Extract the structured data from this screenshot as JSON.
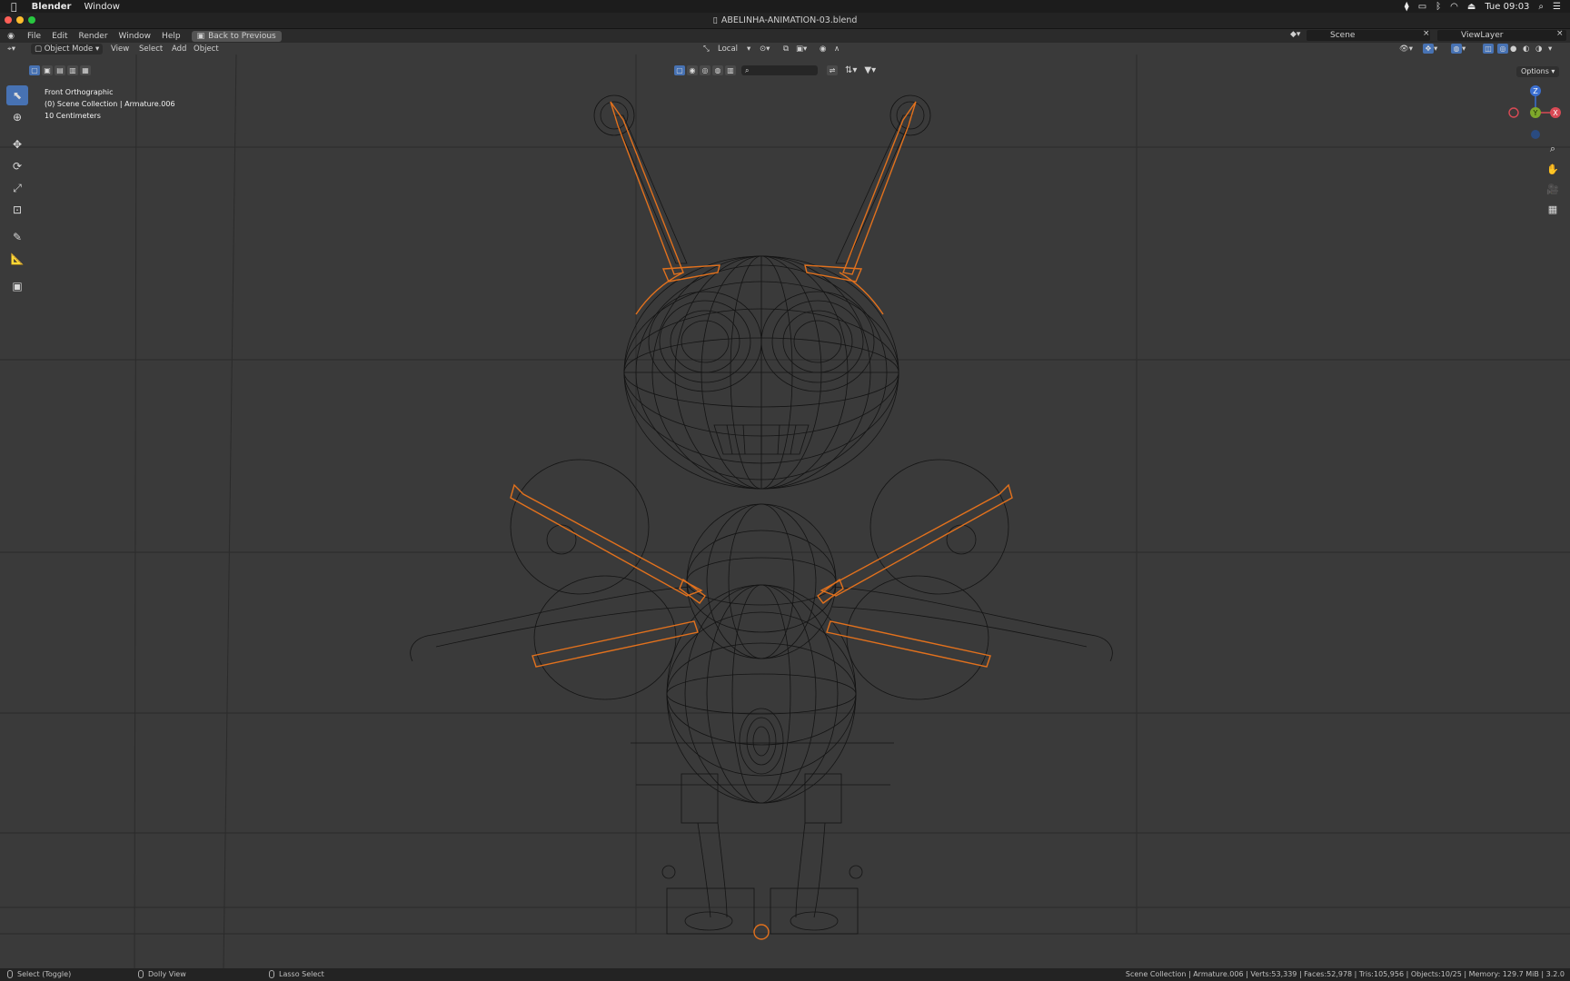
{
  "menubar": {
    "app_name": "Blender",
    "menu_window": "Window",
    "clock": "Tue 09:03"
  },
  "window": {
    "title": "ABELINHA-ANIMATION-03.blend"
  },
  "topmenu": {
    "items": [
      "File",
      "Edit",
      "Render",
      "Window",
      "Help"
    ],
    "back_label": "Back to Previous",
    "scene": "Scene",
    "view_layer": "ViewLayer"
  },
  "viewport_header": {
    "mode": "Object Mode",
    "menus": [
      "View",
      "Select",
      "Add",
      "Object"
    ],
    "orientation": "Local",
    "options_label": "Options"
  },
  "overlay": {
    "view_name": "Front Orthographic",
    "collection": "(0) Scene Collection | Armature.006",
    "scale": "10 Centimeters"
  },
  "tools": [
    "select-box",
    "cursor",
    "move",
    "rotate",
    "scale",
    "transform",
    "annotate",
    "measure",
    "add-cube"
  ],
  "gizmo": {
    "z": "Z",
    "y": "Y",
    "x": "X"
  },
  "statusbar": {
    "left_action": "Select (Toggle)",
    "middle_action": "Dolly View",
    "right_action": "Lasso Select",
    "stats": "Scene Collection | Armature.006 | Verts:53,339 | Faces:52,978 | Tris:105,956 | Objects:10/25 | Memory: 129.7 MiB | 3.2.0"
  },
  "colors": {
    "viewport_bg": "#3a3a3a",
    "wire": "#121212",
    "bone": "#e2711d",
    "accent": "#4772b3"
  }
}
